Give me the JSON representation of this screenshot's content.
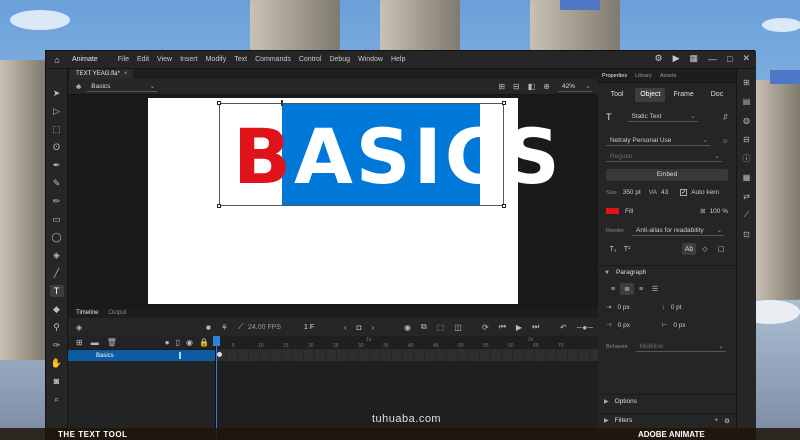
{
  "app": {
    "name": "Animate",
    "menu": [
      "File",
      "Edit",
      "View",
      "Insert",
      "Modify",
      "Text",
      "Commands",
      "Control",
      "Debug",
      "Window",
      "Help"
    ]
  },
  "document": {
    "tab_title": "TEXT YEAG.fla*",
    "close_glyph": "×",
    "scene_name": "Basics",
    "zoom": "42%"
  },
  "stage": {
    "text_first": "B",
    "text_rest": "ASICS",
    "first_color": "#e0121a",
    "selection_color": "#0078d7"
  },
  "timeline": {
    "tabs": [
      "Timeline",
      "Output"
    ],
    "fps": "24.00 FPS",
    "current_frame": "1 F",
    "layer_name": "Basics",
    "ruler": [
      "1s",
      "2s",
      "5",
      "10",
      "15",
      "20",
      "25",
      "30",
      "35",
      "40",
      "45",
      "50",
      "55",
      "60",
      "65",
      "70"
    ]
  },
  "properties": {
    "top_tabs": [
      "Properties",
      "Library",
      "Assets"
    ],
    "subtabs": [
      "Tool",
      "Object",
      "Frame",
      "Doc"
    ],
    "active_subtab": "Object",
    "text_type": "Static Text",
    "font_family": "Netraly Personal Use",
    "font_style": "Regular",
    "embed_label": "Embed",
    "size_label": "Size",
    "size_value": "350 pt",
    "tracking_value": "43",
    "auto_kern_label": "Auto kern",
    "fill_label": "Fill",
    "fill_color": "#e0121a",
    "fill_opacity": "100 %",
    "render_label": "Render",
    "render_value": "Anti-alias for readability",
    "paragraph_label": "Paragraph",
    "indent_left": "0 px",
    "indent_right": "0 pt",
    "margin_left": "0 px",
    "margin_right": "0 px",
    "behavior_label": "Behavior",
    "behavior_value": "Multiline",
    "options_label": "Options",
    "filters_label": "Filters"
  },
  "watermark": "tuhuaba.com",
  "caption": {
    "left": "THE TEXT TOOL",
    "right": "ADOBE ANIMATE"
  }
}
